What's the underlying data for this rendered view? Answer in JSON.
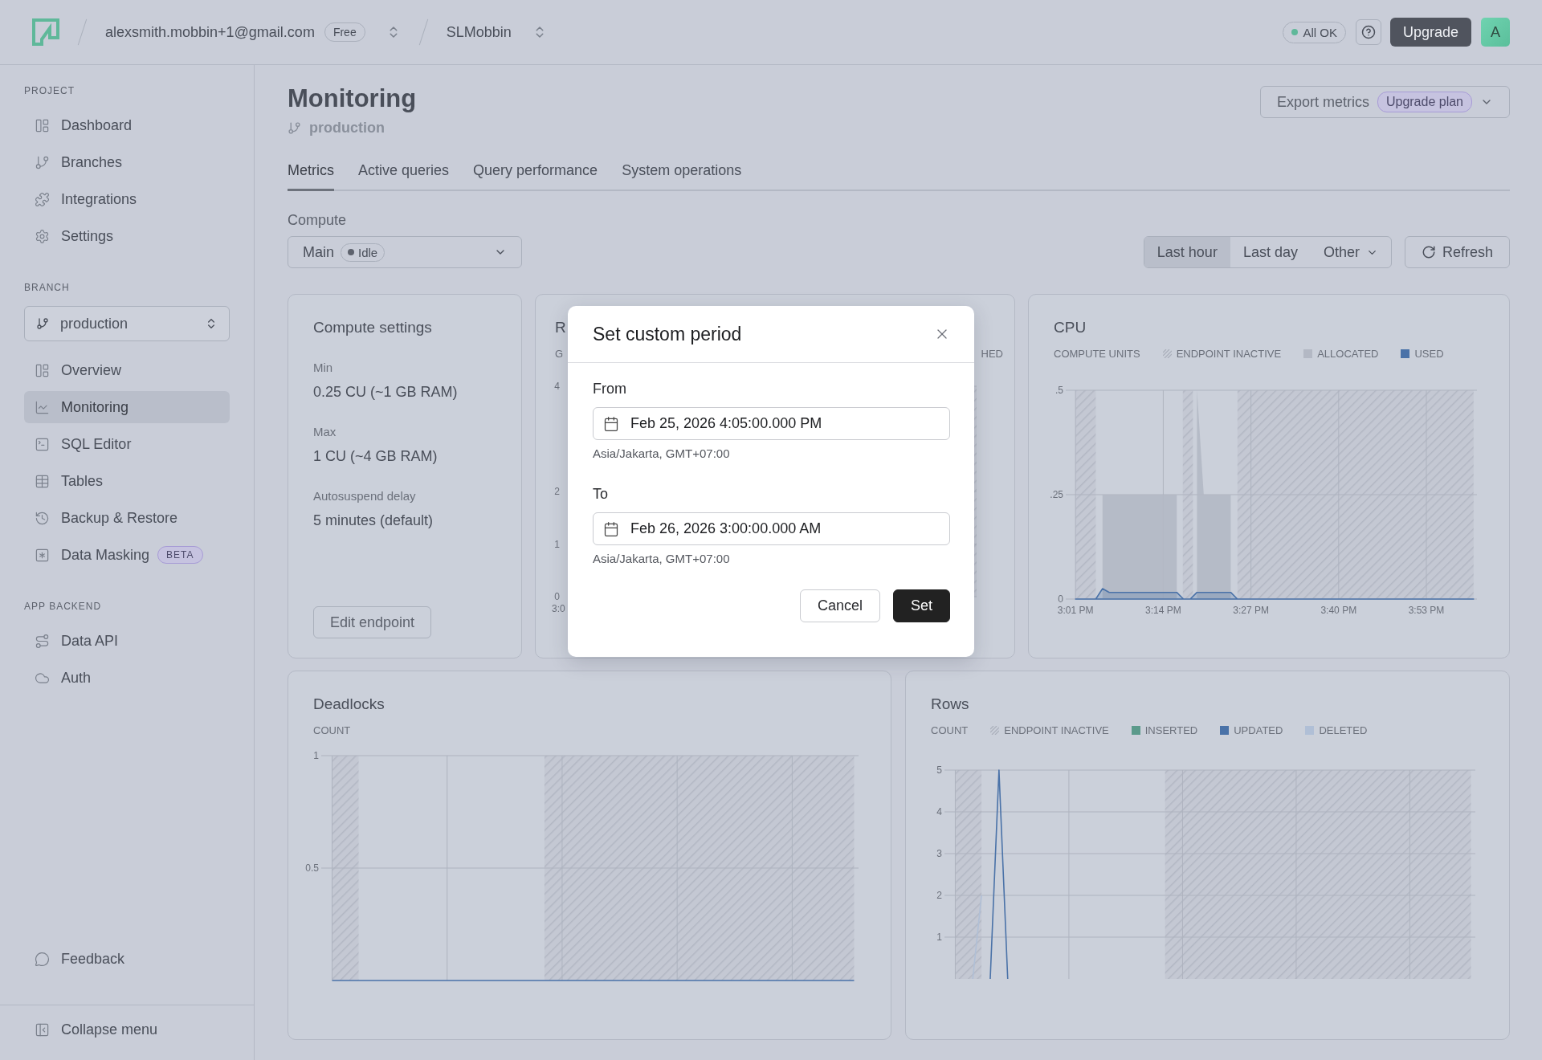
{
  "topbar": {
    "account": "alexsmith.mobbin+1@gmail.com",
    "plan_badge": "Free",
    "project": "SLMobbin",
    "status": "All OK",
    "upgrade_button": "Upgrade",
    "avatar": "A"
  },
  "sidebar": {
    "sections": [
      {
        "heading": "PROJECT",
        "items": [
          {
            "label": "Dashboard",
            "selected": false
          },
          {
            "label": "Branches",
            "selected": false
          },
          {
            "label": "Integrations",
            "selected": false
          },
          {
            "label": "Settings",
            "selected": false
          }
        ]
      },
      {
        "heading": "BRANCH",
        "branch_selector": "production",
        "items": [
          {
            "label": "Overview",
            "selected": false
          },
          {
            "label": "Monitoring",
            "selected": true
          },
          {
            "label": "SQL Editor",
            "selected": false
          },
          {
            "label": "Tables",
            "selected": false
          },
          {
            "label": "Backup & Restore",
            "selected": false
          },
          {
            "label": "Data Masking",
            "selected": false,
            "badge": "BETA"
          }
        ]
      },
      {
        "heading": "APP BACKEND",
        "items": [
          {
            "label": "Data API",
            "selected": false
          },
          {
            "label": "Auth",
            "selected": false
          }
        ]
      }
    ],
    "footer_items": [
      {
        "label": "Feedback"
      }
    ],
    "collapse": "Collapse menu"
  },
  "page": {
    "title": "Monitoring",
    "branch": "production",
    "export_button": "Export metrics",
    "export_badge": "Upgrade plan",
    "tabs": [
      {
        "label": "Metrics",
        "selected": true
      },
      {
        "label": "Active queries",
        "selected": false
      },
      {
        "label": "Query performance",
        "selected": false
      },
      {
        "label": "System operations",
        "selected": false
      }
    ],
    "compute_label": "Compute",
    "compute_select": {
      "value": "Main",
      "status": "Idle"
    },
    "ranges": [
      {
        "label": "Last hour",
        "selected": true,
        "dropdown": false
      },
      {
        "label": "Last day",
        "selected": false,
        "dropdown": false
      },
      {
        "label": "Other",
        "selected": false,
        "dropdown": true
      }
    ],
    "refresh": "Refresh"
  },
  "compute_settings": {
    "title": "Compute settings",
    "fields": [
      {
        "label": "Min",
        "value": "0.25 CU (~1 GB RAM)"
      },
      {
        "label": "Max",
        "value": "1 CU (~4 GB RAM)"
      },
      {
        "label": "Autosuspend delay",
        "value": "5 minutes (default)"
      }
    ],
    "button": "Edit endpoint"
  },
  "hidden_chart": {
    "title": "R",
    "subtitle": "G",
    "legend": "HED",
    "y_labels": [
      "4",
      "2",
      "1",
      "0"
    ],
    "x_label": "3:0"
  },
  "cpu": {
    "title": "CPU",
    "unit": "COMPUTE UNITS",
    "inactive_label": "ENDPOINT INACTIVE",
    "chart_data": {
      "type": "area",
      "grid": true,
      "ylim": [
        0,
        0.5
      ],
      "categories": [
        "3:01 PM",
        null,
        null,
        null,
        null,
        null,
        null,
        null,
        null,
        null,
        null,
        null,
        null,
        "3:14 PM",
        null,
        null,
        null,
        null,
        null,
        null,
        null,
        null,
        null,
        null,
        null,
        null,
        "3:27 PM",
        null,
        null,
        null,
        null,
        null,
        null,
        null,
        null,
        null,
        null,
        null,
        null,
        "3:40 PM",
        null,
        null,
        null,
        null,
        null,
        null,
        null,
        null,
        null,
        null,
        null,
        null,
        "3:53 PM",
        null,
        null,
        null,
        null,
        null,
        null,
        null
      ],
      "yticks": [
        0,
        {
          "value": 0.25,
          "label": ".25"
        },
        {
          "value": 0.5,
          "label": ".5"
        }
      ],
      "series": [
        {
          "name": "ALLOCATED",
          "color": "#b3b8c4",
          "values": [
            null,
            null,
            null,
            null,
            0.25,
            0.25,
            0.25,
            0.25,
            0.25,
            0.25,
            0.25,
            0.25,
            0.25,
            0.25,
            0.25,
            0.25,
            null,
            null,
            0.5,
            0.25,
            0.25,
            0.25,
            0.25,
            0.25,
            null,
            null,
            null,
            null,
            null,
            null,
            null,
            null,
            null,
            null,
            null,
            null,
            null,
            null,
            null,
            null,
            null,
            null,
            null,
            null,
            null,
            null,
            null,
            null,
            null,
            null,
            null,
            null,
            null,
            null,
            null,
            null,
            null,
            null,
            null,
            null
          ]
        },
        {
          "name": "USED",
          "color": "#4a72a8",
          "values": [
            0,
            0,
            0,
            0,
            0.025,
            0.016,
            0.016,
            0.016,
            0.016,
            0.016,
            0.016,
            0.016,
            0.016,
            0.016,
            0.016,
            0.016,
            0,
            0,
            0.016,
            0.016,
            0.016,
            0.016,
            0.016,
            0.016,
            0,
            0,
            0,
            0,
            0,
            0,
            0,
            0,
            0,
            0,
            0,
            0,
            0,
            0,
            0,
            0,
            0,
            0,
            0,
            0,
            0,
            0,
            0,
            0,
            0,
            0,
            0,
            0,
            0,
            0,
            0,
            0,
            0,
            0,
            0,
            0
          ]
        }
      ]
    }
  },
  "deadlocks": {
    "title": "Deadlocks",
    "unit": "COUNT",
    "chart_data": {
      "type": "line",
      "grid": true,
      "ylim": [
        0,
        1
      ],
      "yticks": [
        0.5,
        1
      ],
      "categories": [
        null,
        null,
        null,
        null,
        null,
        null,
        null,
        null,
        null,
        null,
        null,
        null,
        null,
        null,
        null,
        null,
        null,
        null,
        null,
        null,
        null,
        null,
        null,
        null,
        null,
        null,
        null,
        null,
        null,
        null,
        null,
        null,
        null,
        null,
        null,
        null,
        null,
        null,
        null,
        null,
        null,
        null,
        null,
        null,
        null,
        null,
        null,
        null,
        null,
        null,
        null,
        null,
        null,
        null,
        null,
        null,
        null,
        null,
        null,
        null
      ],
      "series": [
        {
          "color": "#4a72a8",
          "values": [
            0,
            0,
            0,
            0,
            0,
            0,
            0,
            0,
            0,
            0,
            0,
            0,
            0,
            0,
            0,
            0,
            0,
            0,
            0,
            0,
            0,
            0,
            0,
            0,
            0,
            0,
            0,
            0,
            0,
            0,
            0,
            0,
            0,
            0,
            0,
            0,
            0,
            0,
            0,
            0,
            0,
            0,
            0,
            0,
            0,
            0,
            0,
            0,
            0,
            0,
            0,
            0,
            0,
            0,
            0,
            0,
            0,
            0,
            0,
            0
          ]
        }
      ]
    }
  },
  "rows": {
    "title": "Rows",
    "unit": "COUNT",
    "inactive_label": "ENDPOINT INACTIVE",
    "chart_data": {
      "type": "line",
      "grid": true,
      "ylim": [
        0,
        5
      ],
      "yticks": [
        1,
        2,
        3,
        4,
        5
      ],
      "categories": [
        null,
        null,
        null,
        null,
        null,
        null,
        null,
        null,
        null,
        null,
        null,
        null,
        null,
        null,
        null,
        null,
        null,
        null,
        null,
        null,
        null,
        null,
        null,
        null,
        null,
        null,
        null,
        null,
        null,
        null,
        null,
        null,
        null,
        null,
        null,
        null,
        null,
        null,
        null,
        null,
        null,
        null,
        null,
        null,
        null,
        null,
        null,
        null,
        null,
        null,
        null,
        null,
        null,
        null,
        null,
        null,
        null,
        null,
        null,
        null
      ],
      "series": [
        {
          "name": "INSERTED",
          "color": "#5b9a8b",
          "values": [
            null,
            null,
            null,
            null,
            null,
            null,
            null,
            null,
            null,
            null,
            null,
            null,
            null,
            null,
            null,
            null,
            null,
            null,
            null,
            null,
            null,
            null,
            null,
            null,
            null,
            null,
            null,
            null,
            null,
            null,
            null,
            null,
            null,
            null,
            null,
            null,
            null,
            null,
            null,
            null,
            null,
            null,
            null,
            null,
            null,
            null,
            null,
            null,
            null,
            null,
            null,
            null,
            null,
            null,
            null,
            null,
            null,
            null,
            null,
            null
          ]
        },
        {
          "name": "UPDATED",
          "color": "#4a72a8",
          "values": [
            null,
            null,
            null,
            null,
            0,
            5,
            0,
            null,
            null,
            null,
            null,
            null,
            null,
            null,
            null,
            null,
            null,
            null,
            null,
            null,
            null,
            null,
            null,
            null,
            null,
            null,
            null,
            null,
            null,
            null,
            null,
            null,
            null,
            null,
            null,
            null,
            null,
            null,
            null,
            null,
            null,
            null,
            null,
            null,
            null,
            null,
            null,
            null,
            null,
            null,
            null,
            null,
            null,
            null,
            null,
            null,
            null,
            null,
            null,
            null
          ]
        },
        {
          "name": "DELETED",
          "color": "#b0bfd6",
          "values": [
            null,
            null,
            0,
            2,
            null,
            null,
            null,
            null,
            null,
            null,
            null,
            null,
            null,
            null,
            null,
            null,
            null,
            null,
            null,
            null,
            null,
            null,
            null,
            null,
            null,
            null,
            null,
            null,
            null,
            null,
            null,
            null,
            null,
            null,
            null,
            null,
            null,
            null,
            null,
            null,
            null,
            null,
            null,
            null,
            null,
            null,
            null,
            null,
            null,
            null,
            null,
            null,
            null,
            null,
            null,
            null,
            null,
            null,
            null,
            null
          ]
        }
      ]
    }
  },
  "dialog": {
    "title": "Set custom period",
    "fields": [
      {
        "label": "From",
        "value": "Feb 25, 2026 4:05:00.000 PM",
        "timezone": "Asia/Jakarta, GMT+07:00"
      },
      {
        "label": "To",
        "value": "Feb 26, 2026 3:00:00.000 AM",
        "timezone": "Asia/Jakarta, GMT+07:00"
      }
    ],
    "buttons": [
      {
        "label": "Cancel",
        "kind": "secondary"
      },
      {
        "label": "Set",
        "kind": "primary"
      }
    ]
  }
}
